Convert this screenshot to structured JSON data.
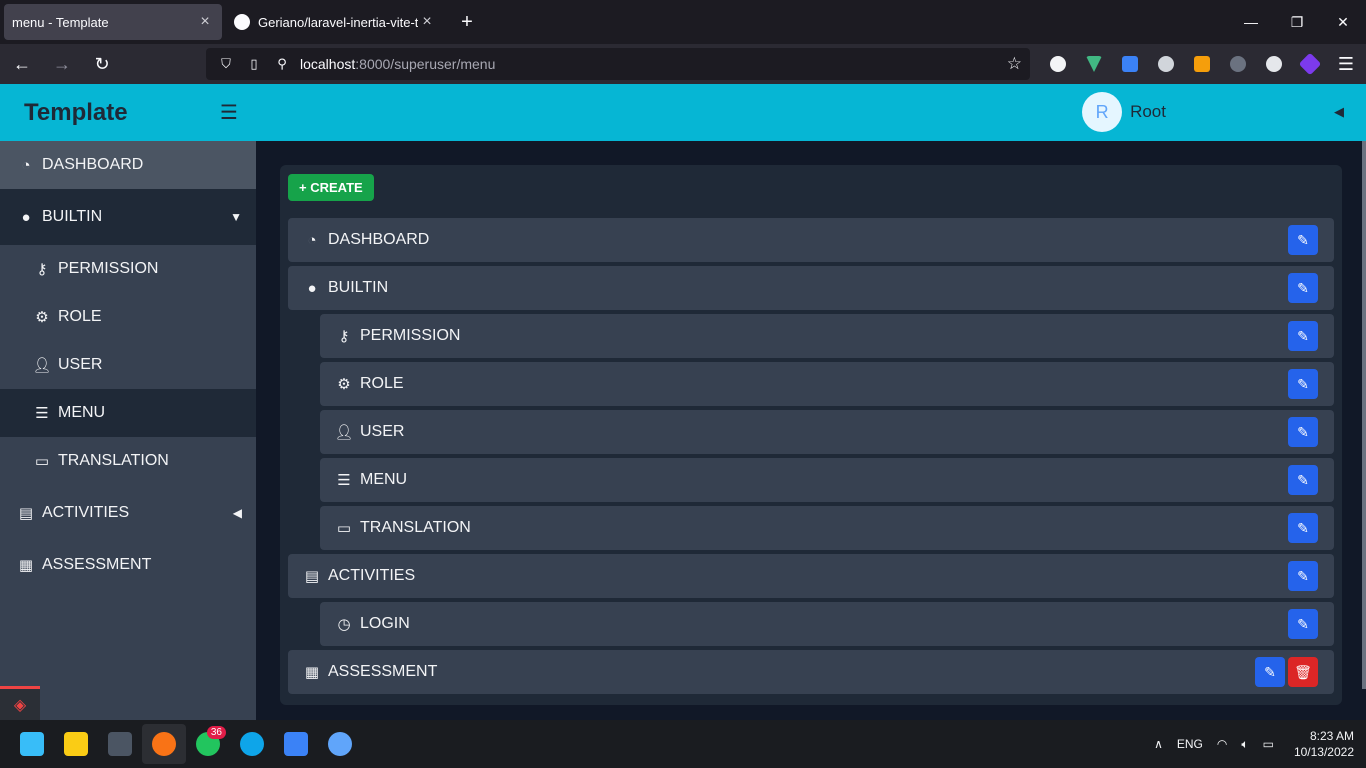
{
  "browser": {
    "tabs": [
      {
        "title": "menu - Template",
        "active": true
      },
      {
        "title": "Geriano/laravel-inertia-vite-tem",
        "active": false
      }
    ],
    "url_host": "localhost",
    "url_path": ":8000/superuser/menu"
  },
  "header": {
    "brand": "Template",
    "avatar_letter": "R",
    "username": "Root"
  },
  "sidebar": {
    "items": [
      {
        "label": "DASHBOARD",
        "icon": "dashboard-icon"
      },
      {
        "label": "BUILTIN",
        "icon": "circle-icon"
      },
      {
        "label": "PERMISSION",
        "icon": "key-icon"
      },
      {
        "label": "ROLE",
        "icon": "user-gear-icon"
      },
      {
        "label": "USER",
        "icon": "user-icon"
      },
      {
        "label": "MENU",
        "icon": "bars-icon"
      },
      {
        "label": "TRANSLATION",
        "icon": "language-icon"
      },
      {
        "label": "ACTIVITIES",
        "icon": "id-card-icon"
      },
      {
        "label": "ASSESSMENT",
        "icon": "file-clock-icon"
      }
    ]
  },
  "main": {
    "create_label": "+ CREATE",
    "rows": [
      {
        "label": "DASHBOARD"
      },
      {
        "label": "BUILTIN"
      },
      {
        "label": "PERMISSION"
      },
      {
        "label": "ROLE"
      },
      {
        "label": "USER"
      },
      {
        "label": "MENU"
      },
      {
        "label": "TRANSLATION"
      },
      {
        "label": "ACTIVITIES"
      },
      {
        "label": "LOGIN"
      },
      {
        "label": "ASSESSMENT"
      }
    ]
  },
  "taskbar": {
    "whatsapp_badge": "36",
    "language": "ENG",
    "time": "8:23 AM",
    "date": "10/13/2022"
  },
  "colors": {
    "header": "#06b6d4",
    "sidebar": "#374151",
    "create": "#16a34a",
    "edit": "#2563eb",
    "delete": "#dc2626"
  }
}
